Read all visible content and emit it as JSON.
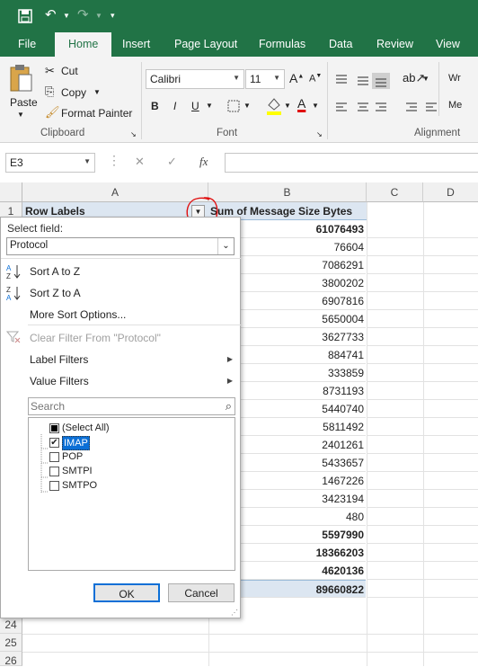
{
  "quick_access": {
    "save_icon": "save-icon",
    "undo_icon": "undo-icon",
    "redo_icon": "redo-icon",
    "customize_icon": "customize-icon"
  },
  "tabs": [
    "File",
    "Home",
    "Insert",
    "Page Layout",
    "Formulas",
    "Data",
    "Review",
    "View"
  ],
  "active_tab": "Home",
  "clipboard": {
    "paste": "Paste",
    "cut": "Cut",
    "copy": "Copy",
    "format_painter": "Format Painter",
    "group": "Clipboard"
  },
  "font": {
    "name": "Calibri",
    "size": "11",
    "bold": "B",
    "italic": "I",
    "underline": "U",
    "group": "Font"
  },
  "alignment": {
    "group": "Alignment",
    "wrap": "Wr",
    "merge": "Me"
  },
  "formula_bar": {
    "name_box": "E3",
    "fx": "fx",
    "cancel": "✕",
    "enter": "✓",
    "value": ""
  },
  "columns": [
    "A",
    "B",
    "C",
    "D"
  ],
  "header_row": {
    "row": "1",
    "a": "Row Labels",
    "b": "Sum of Message Size Bytes"
  },
  "values_b": [
    "61076493",
    "76604",
    "7086291",
    "3800202",
    "6907816",
    "5650004",
    "3627733",
    "884741",
    "333859",
    "8731193",
    "5440740",
    "5811492",
    "2401261",
    "5433657",
    "1467226",
    "3423194",
    "480",
    "5597990",
    "18366203",
    "4620136",
    "89660822"
  ],
  "bold_rows": [
    0,
    17,
    18,
    19,
    20
  ],
  "bottom_rows": [
    "24",
    "25",
    "26"
  ],
  "filter_panel": {
    "select_field_label": "Select field:",
    "field_value": "Protocol",
    "sort_az": "Sort A to Z",
    "sort_za": "Sort Z to A",
    "more_sort": "More Sort Options...",
    "clear_filter": "Clear Filter From \"Protocol\"",
    "label_filters": "Label Filters",
    "value_filters": "Value Filters",
    "search_placeholder": "Search",
    "items": [
      {
        "label": "(Select All)",
        "state": "partial"
      },
      {
        "label": "IMAP",
        "state": "checked"
      },
      {
        "label": "POP",
        "state": "unchecked"
      },
      {
        "label": "SMTPI",
        "state": "unchecked"
      },
      {
        "label": "SMTPO",
        "state": "unchecked"
      }
    ],
    "ok": "OK",
    "cancel": "Cancel"
  },
  "colors": {
    "excel_green": "#217346",
    "annotation_red": "#e01010",
    "selected_blue": "#0b6fd6"
  }
}
